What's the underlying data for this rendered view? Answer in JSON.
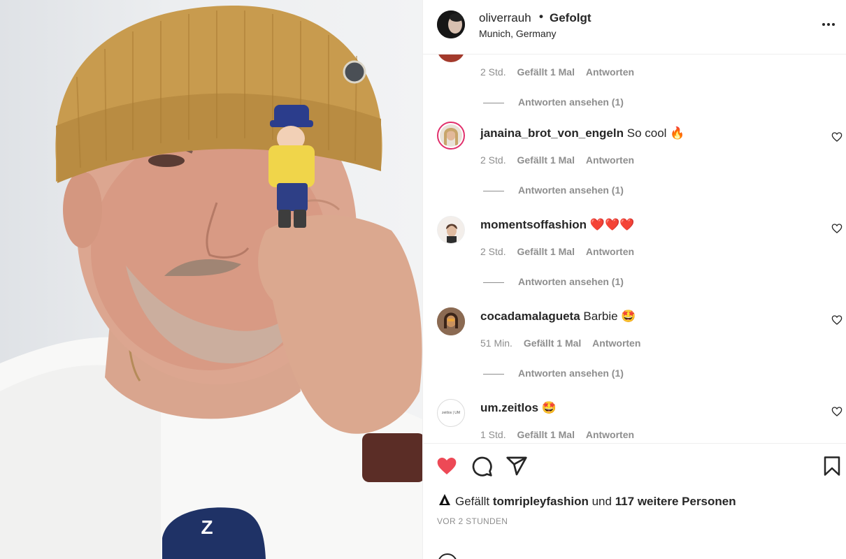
{
  "post": {
    "username": "oliverrauh",
    "separator": "•",
    "follow_status": "Gefolgt",
    "location": "Munich, Germany"
  },
  "comments": [
    {
      "username": "",
      "text": "",
      "time": "2 Std.",
      "likes": "Gefällt 1 Mal",
      "reply": "Antworten",
      "view_replies": "Antworten ansehen (1)"
    },
    {
      "username": "janaina_brot_von_engeln",
      "text": "So cool 🔥",
      "time": "2 Std.",
      "likes": "Gefällt 1 Mal",
      "reply": "Antworten",
      "view_replies": "Antworten ansehen (1)"
    },
    {
      "username": "momentsoffashion",
      "text": "❤️❤️❤️",
      "time": "2 Std.",
      "likes": "Gefällt 1 Mal",
      "reply": "Antworten",
      "view_replies": "Antworten ansehen (1)"
    },
    {
      "username": "cocadamalagueta",
      "text": "Barbie 🤩",
      "time": "51 Min.",
      "likes": "Gefällt 1 Mal",
      "reply": "Antworten",
      "view_replies": "Antworten ansehen (1)"
    },
    {
      "username": "um.zeitlos",
      "text": "🤩",
      "time": "1 Std.",
      "likes": "Gefällt 1 Mal",
      "reply": "Antworten",
      "view_replies": ""
    }
  ],
  "avatar_texts": {
    "um_zeitlos": "zeitlos | UM"
  },
  "actions": {
    "liked": true,
    "like_color": "#ed4956",
    "likes_prefix": "Gefällt",
    "liked_by": "tomripleyfashion",
    "likes_conjunction": "und",
    "likes_others": "117 weitere Personen",
    "time_ago": "VOR 2 STUNDEN"
  },
  "icons": {
    "more": "more-horizontal-icon",
    "heart": "heart-icon",
    "comment": "comment-icon",
    "share": "paper-plane-icon",
    "save": "bookmark-icon"
  },
  "photo": {
    "cap_letter": "Z"
  }
}
